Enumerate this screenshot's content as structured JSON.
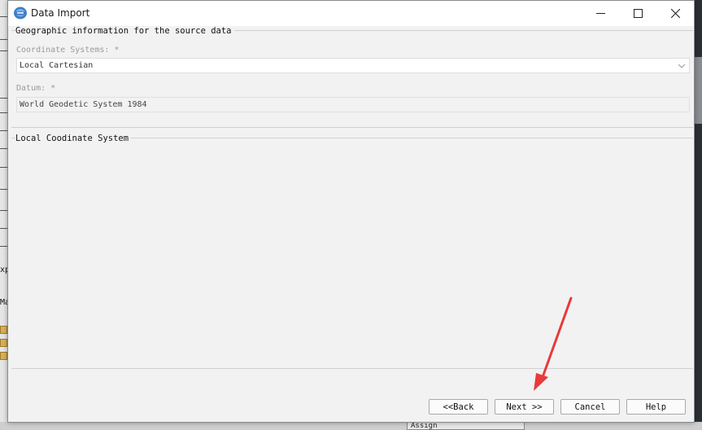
{
  "window": {
    "title": "Data Import",
    "icon": "app-logo-icon"
  },
  "background": {
    "left_fragments": [
      "xp",
      "Ma"
    ],
    "bottom_dropdown": "Assign"
  },
  "geographic_group": {
    "title": "Geographic information for the source data",
    "coordinate_systems": {
      "label": "Coordinate Systems: *",
      "value": "Local Cartesian"
    },
    "datum": {
      "label": "Datum: *",
      "value": "World Geodetic System 1984"
    }
  },
  "local_group": {
    "title": "Local Coodinate System"
  },
  "buttons": {
    "back": "<<Back",
    "next": "Next >>",
    "cancel": "Cancel",
    "help": "Help"
  },
  "colors": {
    "annotation_arrow": "#e83a3a",
    "dialog_background": "#f2f2f2"
  }
}
